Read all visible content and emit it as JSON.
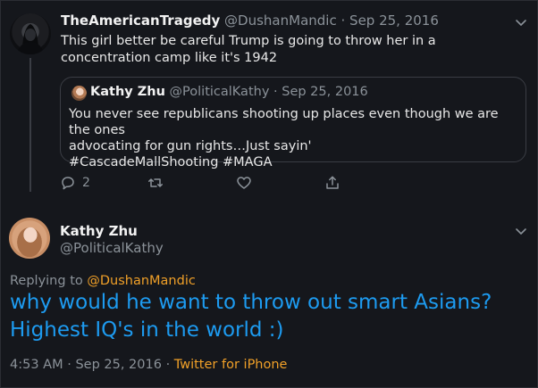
{
  "parent_tweet": {
    "display_name": "TheAmericanTragedy",
    "handle": "@DushanMandic",
    "separator": "·",
    "date": "Sep 25, 2016",
    "text": "This girl better be careful Trump is going to throw her in a concentration camp like it's 1942"
  },
  "quoted_tweet": {
    "display_name": "Kathy Zhu",
    "handle": "@PoliticalKathy",
    "separator": "·",
    "date": "Sep 25, 2016",
    "line1": "You never see republicans shooting up places even though we are the ones",
    "line2": "advocating for gun rights…Just sayin'",
    "line3": "#CascadeMallShooting #MAGA"
  },
  "actions": {
    "reply_count": "2",
    "retweet_count": "",
    "like_count": ""
  },
  "main_tweet": {
    "display_name": "Kathy Zhu",
    "handle": "@PoliticalKathy",
    "replying_prefix": "Replying to ",
    "replying_to": "@DushanMandic",
    "text": "why would he want to throw out smart Asians? Highest IQ's in the world :)",
    "time": "4:53 AM",
    "separator": "·",
    "date": "Sep 25, 2016",
    "source": "Twitter for iPhone"
  },
  "icons": {
    "caret": "chevron-down-icon",
    "reply": "reply-icon",
    "retweet": "retweet-icon",
    "like": "heart-icon",
    "share": "share-icon"
  },
  "colors": {
    "background": "#15171c",
    "link_orange": "#f0a028",
    "tweet_blue": "#1d9bf0",
    "muted": "#8b9299"
  }
}
